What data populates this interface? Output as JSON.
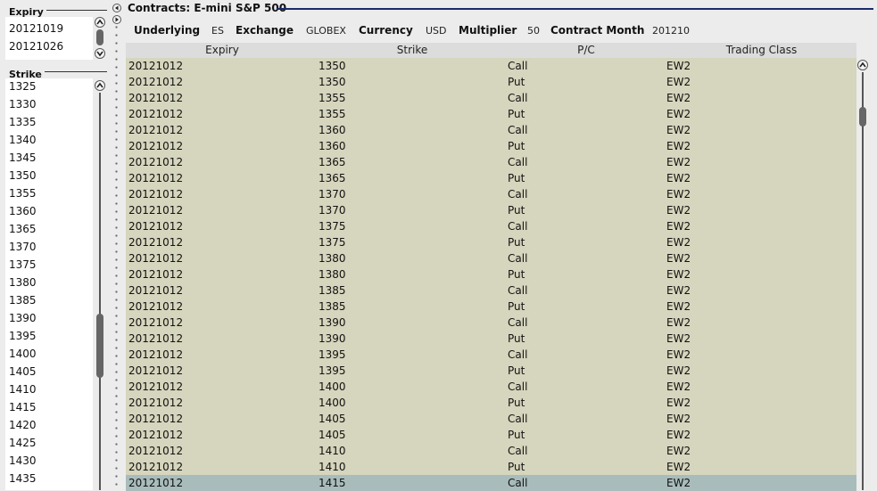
{
  "expiry_panel": {
    "label": "Expiry",
    "items": [
      "20121019",
      "20121026"
    ]
  },
  "strike_panel": {
    "label": "Strike",
    "items": [
      "1325",
      "1330",
      "1335",
      "1340",
      "1345",
      "1350",
      "1355",
      "1360",
      "1365",
      "1370",
      "1375",
      "1380",
      "1385",
      "1390",
      "1395",
      "1400",
      "1405",
      "1410",
      "1415",
      "1420",
      "1425",
      "1430",
      "1435"
    ]
  },
  "contracts": {
    "title": "Contracts: E-mini S&P 500",
    "info": {
      "underlying_label": "Underlying",
      "underlying_value": "ES",
      "exchange_label": "Exchange",
      "exchange_value": "GLOBEX",
      "currency_label": "Currency",
      "currency_value": "USD",
      "multiplier_label": "Multiplier",
      "multiplier_value": "50",
      "month_label": "Contract Month",
      "month_value": "201210"
    },
    "columns": [
      "Expiry",
      "Strike",
      "P/C",
      "Trading Class"
    ],
    "rows": [
      [
        "20121012",
        "1350",
        "Call",
        "EW2"
      ],
      [
        "20121012",
        "1350",
        "Put",
        "EW2"
      ],
      [
        "20121012",
        "1355",
        "Call",
        "EW2"
      ],
      [
        "20121012",
        "1355",
        "Put",
        "EW2"
      ],
      [
        "20121012",
        "1360",
        "Call",
        "EW2"
      ],
      [
        "20121012",
        "1360",
        "Put",
        "EW2"
      ],
      [
        "20121012",
        "1365",
        "Call",
        "EW2"
      ],
      [
        "20121012",
        "1365",
        "Put",
        "EW2"
      ],
      [
        "20121012",
        "1370",
        "Call",
        "EW2"
      ],
      [
        "20121012",
        "1370",
        "Put",
        "EW2"
      ],
      [
        "20121012",
        "1375",
        "Call",
        "EW2"
      ],
      [
        "20121012",
        "1375",
        "Put",
        "EW2"
      ],
      [
        "20121012",
        "1380",
        "Call",
        "EW2"
      ],
      [
        "20121012",
        "1380",
        "Put",
        "EW2"
      ],
      [
        "20121012",
        "1385",
        "Call",
        "EW2"
      ],
      [
        "20121012",
        "1385",
        "Put",
        "EW2"
      ],
      [
        "20121012",
        "1390",
        "Call",
        "EW2"
      ],
      [
        "20121012",
        "1390",
        "Put",
        "EW2"
      ],
      [
        "20121012",
        "1395",
        "Call",
        "EW2"
      ],
      [
        "20121012",
        "1395",
        "Put",
        "EW2"
      ],
      [
        "20121012",
        "1400",
        "Call",
        "EW2"
      ],
      [
        "20121012",
        "1400",
        "Put",
        "EW2"
      ],
      [
        "20121012",
        "1405",
        "Call",
        "EW2"
      ],
      [
        "20121012",
        "1405",
        "Put",
        "EW2"
      ],
      [
        "20121012",
        "1410",
        "Call",
        "EW2"
      ],
      [
        "20121012",
        "1410",
        "Put",
        "EW2"
      ],
      [
        "20121012",
        "1415",
        "Call",
        "EW2"
      ]
    ],
    "selected_row": 26
  },
  "colors": {
    "row_bg": "#d6d5bd",
    "row_selected_bg": "#a9bcbc",
    "header_bg": "#dcdcdc",
    "accent_line": "#1a2a6c"
  }
}
